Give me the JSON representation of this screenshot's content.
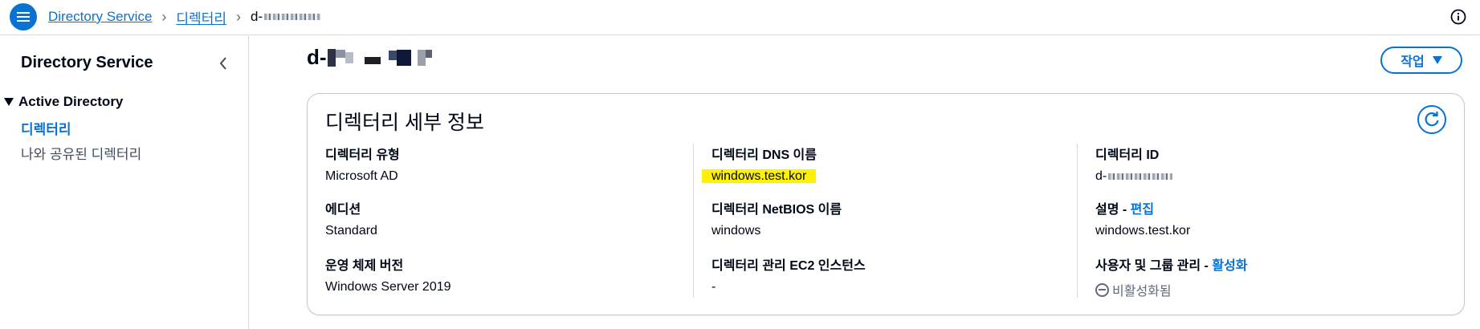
{
  "breadcrumb": {
    "items": [
      "Directory Service",
      "디렉터리"
    ],
    "current": "d-"
  },
  "sidebar": {
    "title": "Directory Service",
    "section": "Active Directory",
    "items": [
      {
        "label": "디렉터리",
        "active": true
      },
      {
        "label": "나와 공유된 디렉터리",
        "active": false
      }
    ]
  },
  "page": {
    "title_prefix": "d-",
    "action_label": "작업"
  },
  "card": {
    "title": "디렉터리 세부 정보",
    "fields": {
      "type_label": "디렉터리 유형",
      "type_value": "Microsoft AD",
      "edition_label": "에디션",
      "edition_value": "Standard",
      "os_label": "운영 체제 버전",
      "os_value": "Windows Server 2019",
      "dns_label_pre": "디렉터리 ",
      "dns_label_bold": "DNS",
      "dns_label_post": " 이름",
      "dns_value": "windows.test.kor",
      "netbios_label_pre": "디렉터리 ",
      "netbios_label_bold": "NetBIOS",
      "netbios_label_post": " 이름",
      "netbios_value": "windows",
      "ec2_label_pre": "디렉터리 관리 ",
      "ec2_label_bold": "EC2",
      "ec2_label_post": " 인스턴스",
      "ec2_value": "-",
      "id_label_pre": "디렉터리 ",
      "id_label_bold": "ID",
      "id_value_prefix": "d-",
      "desc_label": "설명 - ",
      "desc_link": "편집",
      "desc_value": "windows.test.kor",
      "usermgmt_label": "사용자 및 그룹 관리 - ",
      "usermgmt_link": "활성화",
      "usermgmt_status": "비활성화됨"
    }
  },
  "colors": {
    "accent": "#0972d3",
    "highlight": "#fff200",
    "text": "#000716",
    "muted": "#5f6b7a"
  },
  "icons": [
    "menu-icon",
    "chevron-right-icon",
    "info-icon",
    "chevron-left-icon",
    "caret-down-icon",
    "refresh-icon",
    "disabled-status-icon"
  ]
}
